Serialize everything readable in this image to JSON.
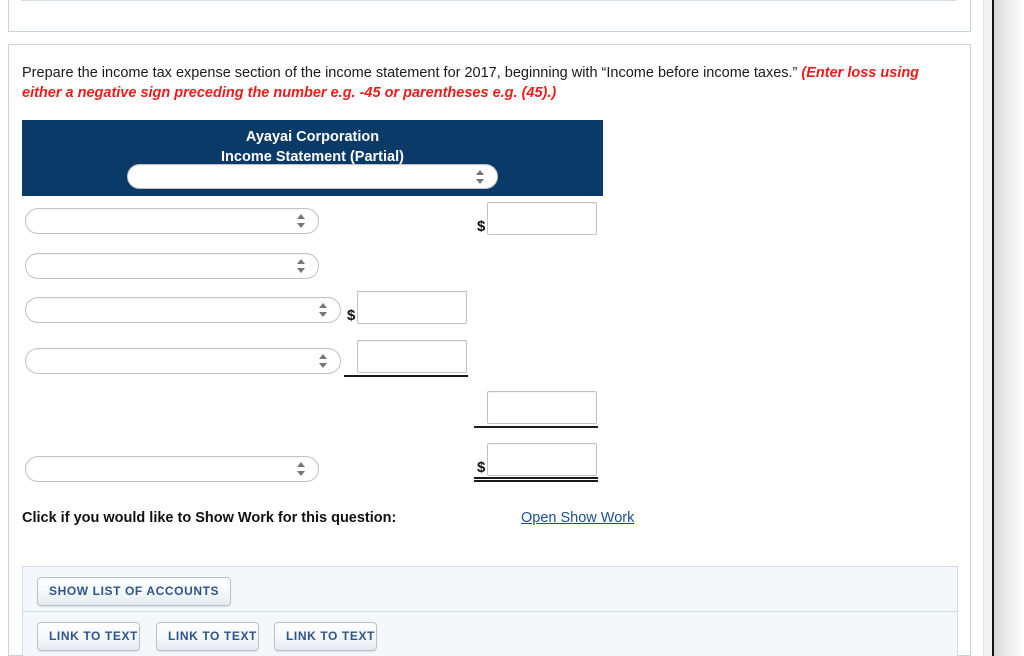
{
  "top_panel": {
    "buttons": [
      {
        "label": ""
      },
      {
        "label": ""
      },
      {
        "label": ""
      }
    ]
  },
  "question": {
    "prompt_text": "Prepare the income tax expense section of the income statement for 2017, beginning with “Income before income taxes.” ",
    "prompt_warning": "(Enter loss using either a negative sign preceding the number e.g. -45 or parentheses e.g. (45).)"
  },
  "statement": {
    "company_name": "Ayayai Corporation",
    "statement_title": "Income Statement (Partial)",
    "header_select_value": "",
    "rows": [
      {
        "select_value": "",
        "amount_value": "",
        "currency": "$"
      },
      {
        "select_value": "",
        "amount_value": "",
        "currency": ""
      },
      {
        "select_value": "",
        "amount_value": "",
        "currency": "$"
      },
      {
        "select_value": "",
        "amount_value": "",
        "currency": ""
      },
      {
        "select_value": "",
        "amount_value": "",
        "currency": ""
      },
      {
        "select_value": "",
        "amount_value": "",
        "currency": "$"
      }
    ]
  },
  "show_work": {
    "label": "Click if you would like to Show Work for this question:",
    "link_label": "Open Show Work"
  },
  "bottom_panel": {
    "show_list_label": "SHOW LIST OF ACCOUNTS",
    "link_to_text_labels": [
      "LINK TO TEXT",
      "LINK TO TEXT",
      "LINK TO TEXT"
    ]
  },
  "colors": {
    "header_navy": "#0a3a68",
    "warning_red": "#ef1b1b",
    "link_blue": "#1a4f96",
    "button_text_blue": "#2d5490",
    "panel_bg": "#f4f8fb"
  }
}
